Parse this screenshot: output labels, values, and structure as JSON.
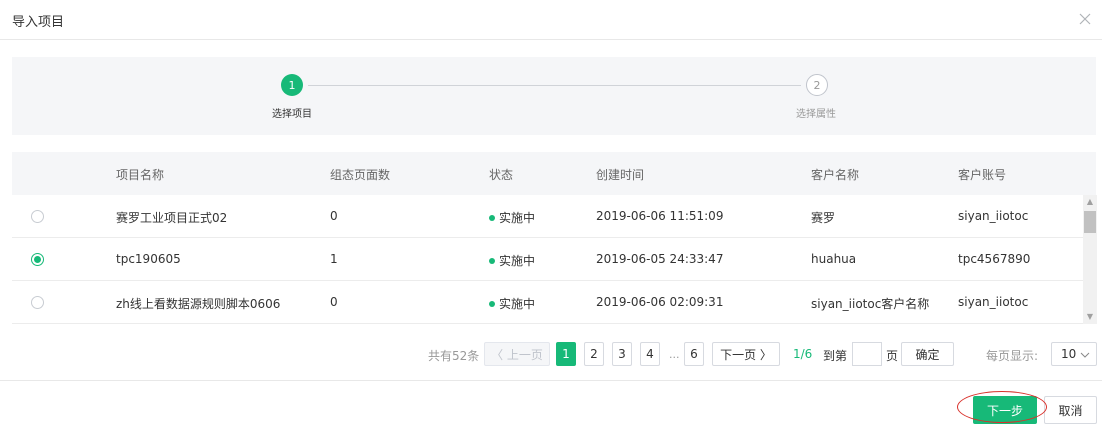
{
  "dialog": {
    "title": "导入项目"
  },
  "steps": [
    {
      "number": "1",
      "label": "选择项目"
    },
    {
      "number": "2",
      "label": "选择属性"
    }
  ],
  "table": {
    "columns": [
      "项目名称",
      "组态页面数",
      "状态",
      "创建时间",
      "客户名称",
      "客户账号"
    ],
    "rows": [
      {
        "selected": false,
        "name": "赛罗工业项目正式02",
        "pages": "0",
        "status": "实施中",
        "created": "2019-06-06 11:51:09",
        "customer": "赛罗",
        "account": "siyan_iiotoc"
      },
      {
        "selected": true,
        "name": "tpc190605",
        "pages": "1",
        "status": "实施中",
        "created": "2019-06-05 24:33:47",
        "customer": "huahua",
        "account": "tpc4567890"
      },
      {
        "selected": false,
        "name": "zh线上看数据源规则脚本0606",
        "pages": "0",
        "status": "实施中",
        "created": "2019-06-06 02:09:31",
        "customer": "siyan_iiotoc客户名称",
        "account": "siyan_iiotoc"
      }
    ]
  },
  "pagination": {
    "total": "共有52条",
    "prev": "〈 上一页",
    "pages": [
      "1",
      "2",
      "3",
      "4",
      "6"
    ],
    "ellipsis": "...",
    "next": "下一页 〉",
    "page_count": "1/6",
    "goto_label": "到第",
    "page_unit": "页",
    "confirm": "确定",
    "page_size_label": "每页显示:",
    "page_size": "10"
  },
  "footer": {
    "next_step": "下一步",
    "cancel": "取消"
  },
  "colors": {
    "accent": "#17b978",
    "highlight": "#d9312b"
  }
}
